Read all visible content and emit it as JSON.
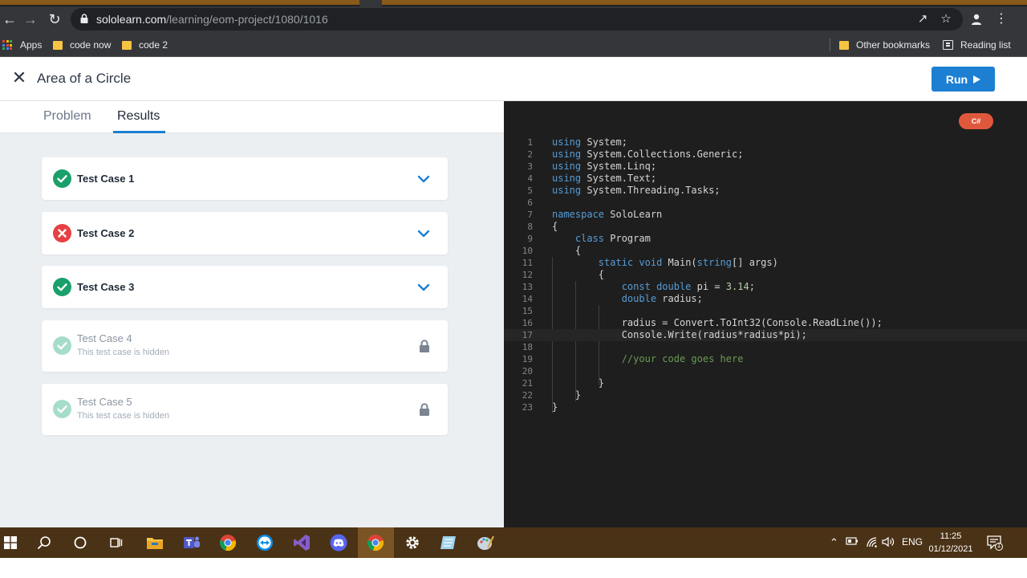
{
  "browser": {
    "url_domain": "sololearn.com",
    "url_path": "/learning/eom-project/1080/1016",
    "bookmarks": [
      {
        "label": "Apps"
      },
      {
        "label": "code now"
      },
      {
        "label": "code 2"
      }
    ],
    "other_bookmarks_label": "Other bookmarks",
    "reading_list_label": "Reading list"
  },
  "header": {
    "title": "Area of a Circle",
    "run_label": "Run"
  },
  "tabs": [
    {
      "label": "Problem",
      "active": false
    },
    {
      "label": "Results",
      "active": true
    }
  ],
  "test_cases": [
    {
      "title": "Test Case 1",
      "status": "pass",
      "subtitle": "",
      "locked": false
    },
    {
      "title": "Test Case 2",
      "status": "fail",
      "subtitle": "",
      "locked": false
    },
    {
      "title": "Test Case 3",
      "status": "pass",
      "subtitle": "",
      "locked": false
    },
    {
      "title": "Test Case 4",
      "status": "hidden",
      "subtitle": "This test case is hidden",
      "locked": true
    },
    {
      "title": "Test Case 5",
      "status": "hidden",
      "subtitle": "This test case is hidden",
      "locked": true
    }
  ],
  "editor": {
    "language_badge": "C#",
    "current_line": 17,
    "lines": [
      "using System;",
      "using System.Collections.Generic;",
      "using System.Linq;",
      "using System.Text;",
      "using System.Threading.Tasks;",
      "",
      "namespace SoloLearn",
      "{",
      "    class Program",
      "    {",
      "        static void Main(string[] args)",
      "        {",
      "            const double pi = 3.14;",
      "            double radius;",
      "",
      "            radius = Convert.ToInt32(Console.ReadLine());",
      "            Console.Write(radius*radius*pi);",
      "",
      "            //your code goes here",
      "",
      "        }",
      "    }",
      "}"
    ]
  },
  "taskbar": {
    "language": "ENG",
    "time": "11:25",
    "date": "01/12/2021",
    "notification_count": "1"
  }
}
